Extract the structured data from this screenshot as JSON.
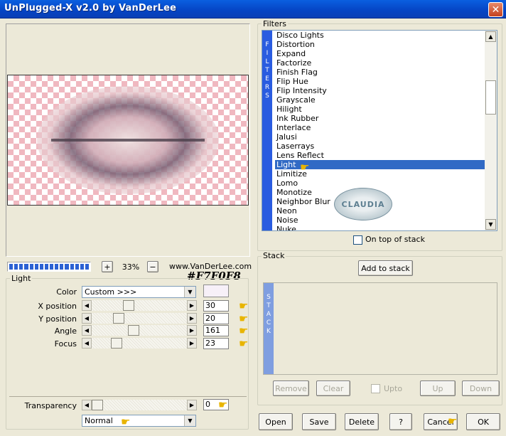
{
  "window": {
    "title": "UnPlugged-X v2.0 by VanDerLee",
    "close": "✕"
  },
  "preview": {
    "zoom": "33%",
    "plus": "+",
    "minus": "−",
    "credit": "www.VanDerLee.com",
    "progress_segments": 16
  },
  "light": {
    "group_label": "Light",
    "color_label": "Color",
    "color_value": "Custom >>>",
    "swatch_color": "#F7F0F8",
    "hex_annotation": "#F7F0F8",
    "params": [
      {
        "label": "X position",
        "value": "30",
        "thumb_fraction": 0.38
      },
      {
        "label": "Y position",
        "value": "20",
        "thumb_fraction": 0.26
      },
      {
        "label": "Angle",
        "value": "161",
        "thumb_fraction": 0.44
      },
      {
        "label": "Focus",
        "value": "23",
        "thumb_fraction": 0.23
      }
    ],
    "transparency_label": "Transparency",
    "transparency_value": "0",
    "blend_mode": "Normal"
  },
  "filters": {
    "group_label": "Filters",
    "tab_letters": [
      "F",
      "I",
      "L",
      "T",
      "E",
      "R",
      "S"
    ],
    "items": [
      "Disco Lights",
      "Distortion",
      "Expand",
      "Factorize",
      "Finish Flag",
      "Flip Hue",
      "Flip Intensity",
      "Grayscale",
      "Hilight",
      "Ink Rubber",
      "Interlace",
      "Jalusi",
      "Laserrays",
      "Lens Reflect",
      "Light",
      "Limitize",
      "Lomo",
      "Monotize",
      "Neighbor Blur",
      "Neon",
      "Noise",
      "Nuke"
    ],
    "selected": "Light",
    "on_top_label": "On top of stack",
    "stamp_text": "CLAUDIA"
  },
  "stack": {
    "group_label": "Stack",
    "add_label": "Add to stack",
    "tab_letters": [
      "S",
      "T",
      "A",
      "C",
      "K"
    ],
    "remove": "Remove",
    "clear": "Clear",
    "upto": "Upto",
    "up": "Up",
    "down": "Down"
  },
  "footer": {
    "open": "Open",
    "save": "Save",
    "delete": "Delete",
    "help": "?",
    "cancel": "Cancel",
    "ok": "OK"
  },
  "icons": {
    "pointer": "hand-pointer-icon"
  }
}
